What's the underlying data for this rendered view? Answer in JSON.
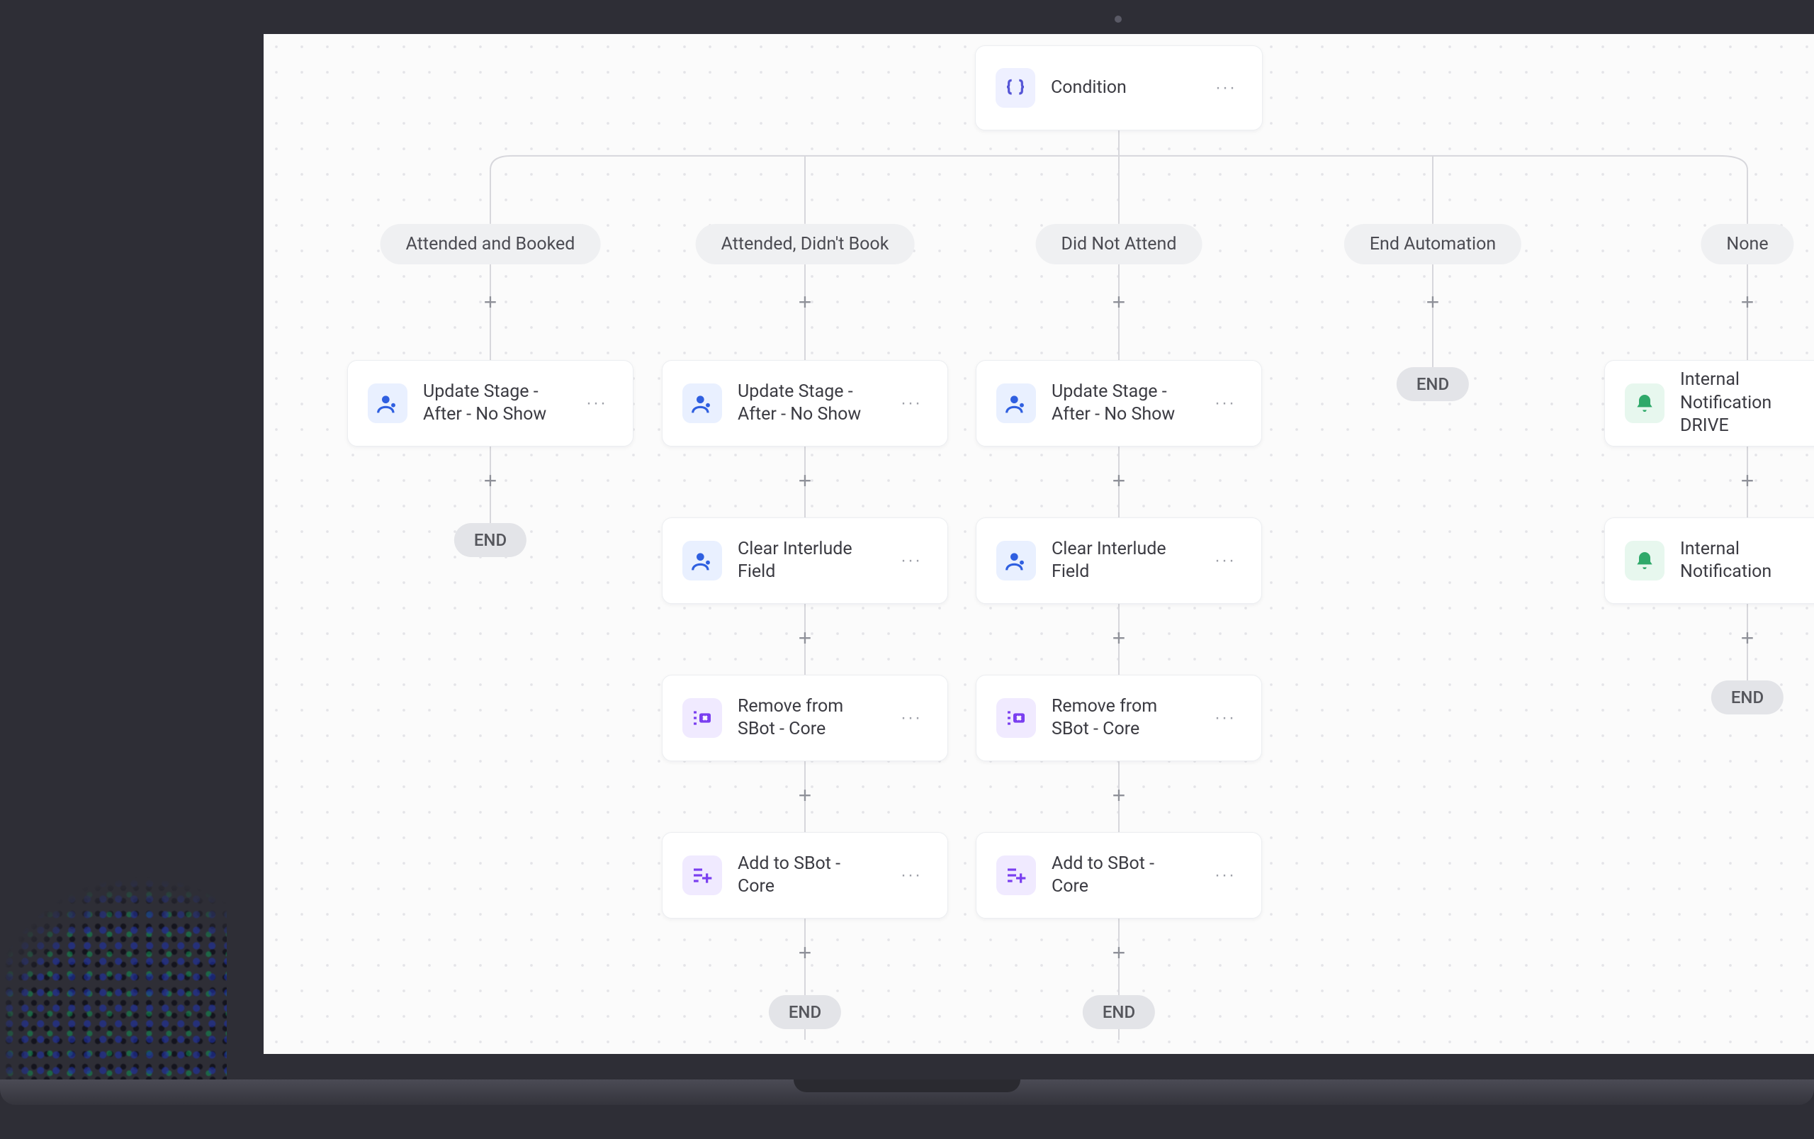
{
  "condition": {
    "label": "Condition"
  },
  "branches": [
    {
      "label": "Attended and Booked",
      "steps": [
        {
          "icon": "person",
          "label": "Update Stage - After - No Show"
        }
      ],
      "end": true
    },
    {
      "label": "Attended, Didn't Book",
      "steps": [
        {
          "icon": "person",
          "label": "Update Stage - After - No Show"
        },
        {
          "icon": "person",
          "label": "Clear Interlude Field"
        },
        {
          "icon": "remove-list",
          "label": "Remove from SBot - Core"
        },
        {
          "icon": "add-list",
          "label": "Add to SBot - Core"
        }
      ],
      "end": true
    },
    {
      "label": "Did Not Attend",
      "steps": [
        {
          "icon": "person",
          "label": "Update Stage - After - No Show"
        },
        {
          "icon": "person",
          "label": "Clear Interlude Field"
        },
        {
          "icon": "remove-list",
          "label": "Remove from SBot - Core"
        },
        {
          "icon": "add-list",
          "label": "Add to SBot - Core"
        }
      ],
      "end": true
    },
    {
      "label": "End Automation",
      "steps": [],
      "end": true
    },
    {
      "label": "None",
      "steps": [
        {
          "icon": "bell",
          "label": "Internal Notification DRIVE"
        },
        {
          "icon": "bell",
          "label": "Internal Notification"
        }
      ],
      "end": true
    }
  ],
  "end_label": "END"
}
